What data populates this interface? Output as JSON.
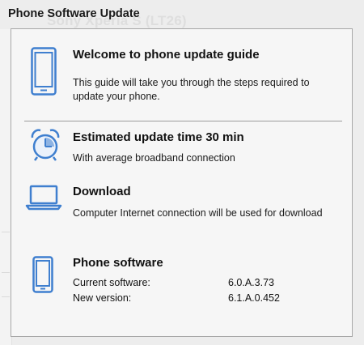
{
  "dialog": {
    "title": "Phone Software Update"
  },
  "background": {
    "device_title": "Sony Xperia S (LT26)"
  },
  "welcome": {
    "icon": "phone-outline-icon",
    "heading": "Welcome to phone update guide",
    "text": "This guide will take you through the steps required to update your phone."
  },
  "estimate": {
    "icon": "alarm-clock-icon",
    "heading": "Estimated update time 30 min",
    "text": "With average broadband connection"
  },
  "download": {
    "icon": "laptop-icon",
    "heading": "Download",
    "text": "Computer Internet connection will be used for download"
  },
  "software": {
    "icon": "phone-small-icon",
    "heading": "Phone software",
    "current_label": "Current software:",
    "current_value": "6.0.A.3.73",
    "new_label": "New version:",
    "new_value": "6.1.A.0.452"
  },
  "colors": {
    "icon_blue": "#3f7fcf",
    "panel_bg": "#f6f6f6",
    "window_bg": "#ededed"
  }
}
